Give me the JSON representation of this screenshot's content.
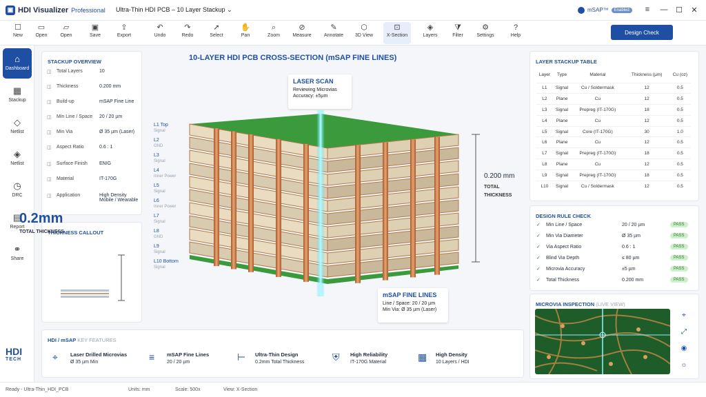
{
  "app": {
    "name": "HDI Visualizer",
    "edition": "Professional",
    "document_title": "Ultra-Thin HDI PCB – 10 Layer Stackup",
    "msap_label": "mSAP™",
    "msap_badge": "Enabled"
  },
  "toolbar": [
    {
      "label": "New",
      "icon": "new-file-icon"
    },
    {
      "label": "Open",
      "icon": "open-icon"
    },
    {
      "label": "Open",
      "icon": "folder-icon"
    },
    {
      "label": "Save",
      "icon": "save-icon"
    },
    {
      "label": "Export",
      "icon": "export-icon"
    },
    {
      "label": "Undo",
      "icon": "undo-icon"
    },
    {
      "label": "Redo",
      "icon": "redo-icon"
    },
    {
      "label": "Select",
      "icon": "cursor-icon"
    },
    {
      "label": "Pan",
      "icon": "hand-icon"
    },
    {
      "label": "Zoom",
      "icon": "zoom-icon"
    },
    {
      "label": "Measure",
      "icon": "ruler-icon"
    },
    {
      "label": "Annotate",
      "icon": "pen-icon"
    },
    {
      "label": "3D View",
      "icon": "cube-icon"
    },
    {
      "label": "X-Section",
      "icon": "section-icon"
    },
    {
      "label": "Layers",
      "icon": "layers-icon"
    },
    {
      "label": "Filter",
      "icon": "filter-icon"
    },
    {
      "label": "Settings",
      "icon": "gear-icon"
    },
    {
      "label": "Help",
      "icon": "help-icon"
    }
  ],
  "design_check_label": "Design Check",
  "sidenav": [
    {
      "label": "Dashboard"
    },
    {
      "label": "Stackup"
    },
    {
      "label": "Netlist"
    },
    {
      "label": "Netlist"
    },
    {
      "label": "DRC"
    },
    {
      "label": "Report"
    },
    {
      "label": "Share"
    }
  ],
  "brand": {
    "line1": "HDI",
    "line2": "TECH"
  },
  "overview": {
    "title": "STACKUP OVERVIEW",
    "rows": [
      {
        "label": "Total Layers",
        "value": "10"
      },
      {
        "label": "Thickness",
        "value": "0.200 mm"
      },
      {
        "label": "Build-up",
        "value": "mSAP Fine Line"
      },
      {
        "label": "Min Line / Space",
        "value": "20 / 20 µm"
      },
      {
        "label": "Min Via",
        "value": "Ø 35 µm (Laser)"
      },
      {
        "label": "Aspect Ratio",
        "value": "0.6 : 1"
      },
      {
        "label": "Surface Finish",
        "value": "ENIG"
      },
      {
        "label": "Material",
        "value": "IT-170G"
      },
      {
        "label": "Application",
        "value": "High Density Mobile / Wearable"
      }
    ]
  },
  "thickness_callout": {
    "title": "THICKNESS CALLOUT",
    "value": "0.2mm",
    "label": "TOTAL THICKNESS"
  },
  "cross_section": {
    "title": "10-LAYER HDI PCB CROSS-SECTION (mSAP FINE LINES)",
    "laser": {
      "title": "LASER SCAN",
      "line1": "Reviewing Microvias",
      "line2": "Accuracy: ±5µm"
    },
    "thickness": {
      "value": "0.200 mm",
      "label1": "TOTAL",
      "label2": "THICKNESS"
    },
    "fine": {
      "title": "mSAP FINE LINES",
      "line1": "Line / Space: 20 / 20 µm",
      "line2": "Min Via: Ø 35 µm (Laser)"
    },
    "layers": [
      {
        "name": "L1 Top",
        "type": "Signal"
      },
      {
        "name": "L2",
        "type": "GND"
      },
      {
        "name": "L3",
        "type": "Signal"
      },
      {
        "name": "L4",
        "type": "Inner Power"
      },
      {
        "name": "L5",
        "type": "Signal"
      },
      {
        "name": "L6",
        "type": "Inner Power"
      },
      {
        "name": "L7",
        "type": "Signal"
      },
      {
        "name": "L8",
        "type": "GND"
      },
      {
        "name": "L9",
        "type": "Signal"
      },
      {
        "name": "L10 Bottom",
        "type": "Signal"
      }
    ]
  },
  "stack_table": {
    "title": "LAYER STACKUP TABLE",
    "headers": [
      "Layer",
      "Type",
      "Material",
      "Thickness (µm)",
      "Cu (oz)"
    ],
    "rows": [
      [
        "L1",
        "Signal",
        "Cu / Soldermask",
        "12",
        "0.5"
      ],
      [
        "L2",
        "Plane",
        "Cu",
        "12",
        "0.5"
      ],
      [
        "L3",
        "Signal",
        "Prepreg (IT-170G)",
        "18",
        "0.5"
      ],
      [
        "L4",
        "Plane",
        "Cu",
        "12",
        "0.5"
      ],
      [
        "L5",
        "Signal",
        "Core (IT-170G)",
        "30",
        "1.0"
      ],
      [
        "L6",
        "Plane",
        "Cu",
        "12",
        "0.5"
      ],
      [
        "L7",
        "Signal",
        "Prepreg (IT-170G)",
        "18",
        "0.5"
      ],
      [
        "L8",
        "Plane",
        "Cu",
        "12",
        "0.5"
      ],
      [
        "L9",
        "Signal",
        "Prepreg (IT-170G)",
        "18",
        "0.5"
      ],
      [
        "L10",
        "Signal",
        "Cu / Soldermask",
        "12",
        "0.5"
      ]
    ]
  },
  "drc": {
    "title": "DESIGN RULE CHECK",
    "rows": [
      {
        "name": "Min Line / Space",
        "value": "20 / 20 µm",
        "status": "PASS"
      },
      {
        "name": "Min Via Diameter",
        "value": "Ø 35 µm",
        "status": "PASS"
      },
      {
        "name": "Via Aspect Ratio",
        "value": "0.6 : 1",
        "status": "PASS"
      },
      {
        "name": "Blind Via Depth",
        "value": "≤ 80 µm",
        "status": "PASS"
      },
      {
        "name": "Microvia Accuracy",
        "value": "±5 µm",
        "status": "PASS"
      },
      {
        "name": "Total Thickness",
        "value": "0.200 mm",
        "status": "PASS"
      }
    ]
  },
  "microvia": {
    "title": "MICROVIA INSPECTION",
    "subtitle": "(LIVE VIEW)"
  },
  "features": {
    "title": "HDI / mSAP",
    "subtitle": "KEY FEATURES",
    "items": [
      {
        "title": "Laser Drilled Microvias",
        "sub": "Ø 35 µm Min",
        "icon": "target-icon"
      },
      {
        "title": "mSAP Fine Lines",
        "sub": "20 / 20 µm",
        "icon": "lines-icon"
      },
      {
        "title": "Ultra-Thin Design",
        "sub": "0.2mm Total Thickness",
        "icon": "thin-icon"
      },
      {
        "title": "High Reliability",
        "sub": "IT-170G Material",
        "icon": "shield-icon"
      },
      {
        "title": "High Density",
        "sub": "10 Layers / HDI",
        "icon": "chip-icon"
      }
    ]
  },
  "status": {
    "ready": "Ready - Ultra-Thin_HDI_PCB",
    "units": "Units: mm",
    "scale": "Scale: 500x",
    "view": "View: X-Section"
  }
}
